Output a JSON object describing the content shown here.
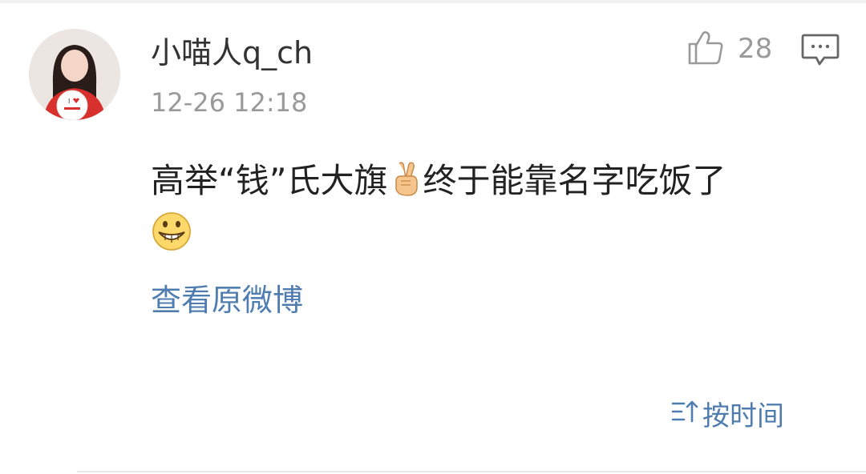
{
  "comment": {
    "author": {
      "name": "小喵人q_ch",
      "avatar_icon": "avatar-girl-with-balloon"
    },
    "timestamp": "12-26 12:18",
    "likes": "28",
    "text_part1": "高举“钱”氏大旗",
    "text_part2": "终于能靠名字吃饭了",
    "emojis": [
      "victory-hand-emoji",
      "grinning-face-emoji"
    ],
    "view_original_label": "查看原微博"
  },
  "footer": {
    "sort_label": "按时间",
    "sort_icon": "sort-arrow-icon"
  },
  "colors": {
    "link": "#507daf",
    "muted": "#9a9a9a",
    "text": "#222222"
  }
}
